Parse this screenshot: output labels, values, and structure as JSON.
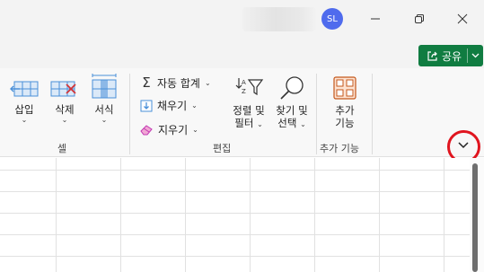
{
  "titlebar": {
    "avatar_initials": "SL",
    "min_label": "–",
    "restore_icon": "restore-icon",
    "close_icon": "close-icon"
  },
  "share": {
    "label": "공유",
    "icon": "share-icon",
    "color": "#107c41"
  },
  "ribbon": {
    "cells_group": {
      "label": "셀",
      "insert_label": "삽입",
      "delete_label": "삭제",
      "format_label": "서식"
    },
    "editing_group": {
      "label": "편집",
      "autosum_label": "자동 합계",
      "fill_label": "채우기",
      "clear_label": "지우기",
      "sort_filter_line1": "정렬 및",
      "sort_filter_line2": "필터",
      "find_select_line1": "찾기 및",
      "find_select_line2": "선택"
    },
    "addins_group": {
      "label": "추가 기능",
      "addins_line1": "추가",
      "addins_line2": "기능"
    },
    "caret": "⌄",
    "accent_color": "#4a90d9",
    "highlight_color": "#e0151f"
  }
}
